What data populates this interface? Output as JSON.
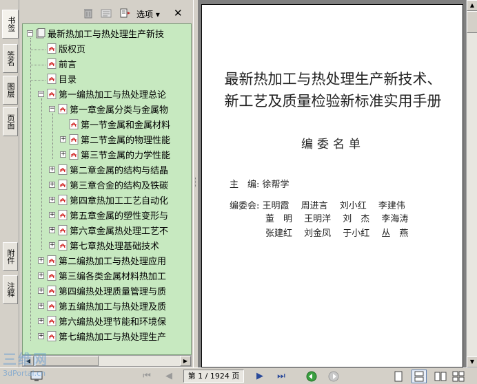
{
  "left_tabs": [
    "书签",
    "签名",
    "图层",
    "页面",
    "附件",
    "注释"
  ],
  "bookmarks_toolbar": {
    "options_label": "选项 ▾",
    "close_glyph": "✕"
  },
  "bookmarks": [
    {
      "label": "最新热加工与热处理生产新技",
      "level": 0,
      "expander": "minus",
      "root": true
    },
    {
      "label": "版权页",
      "level": 1,
      "expander": "none"
    },
    {
      "label": "前言",
      "level": 1,
      "expander": "none"
    },
    {
      "label": "目录",
      "level": 1,
      "expander": "none"
    },
    {
      "label": "第一编热加工与热处理总论",
      "level": 1,
      "expander": "minus"
    },
    {
      "label": "第一章金属分类与金属物",
      "level": 2,
      "expander": "minus"
    },
    {
      "label": "第一节金属和金属材料",
      "level": 3,
      "expander": "none"
    },
    {
      "label": "第二节金属的物理性能",
      "level": 3,
      "expander": "plus"
    },
    {
      "label": "第三节金属的力学性能",
      "level": 3,
      "expander": "plus"
    },
    {
      "label": "第二章金属的结构与结晶",
      "level": 2,
      "expander": "plus"
    },
    {
      "label": "第三章合金的结构及铁碳",
      "level": 2,
      "expander": "plus"
    },
    {
      "label": "第四章热加工工艺自动化",
      "level": 2,
      "expander": "plus"
    },
    {
      "label": "第五章金属的塑性变形与",
      "level": 2,
      "expander": "plus"
    },
    {
      "label": "第六章金属热处理工艺不",
      "level": 2,
      "expander": "plus"
    },
    {
      "label": "第七章热处理基础技术",
      "level": 2,
      "expander": "plus"
    },
    {
      "label": "第二编热加工与热处理应用",
      "level": 1,
      "expander": "plus"
    },
    {
      "label": "第三编各类金属材料热加工",
      "level": 1,
      "expander": "plus"
    },
    {
      "label": "第四编热处理质量管理与质",
      "level": 1,
      "expander": "plus"
    },
    {
      "label": "第五编热加工与热处理及质",
      "level": 1,
      "expander": "plus"
    },
    {
      "label": "第六编热处理节能和环境保",
      "level": 1,
      "expander": "plus"
    },
    {
      "label": "第七编热加工与热处理生产",
      "level": 1,
      "expander": "plus"
    }
  ],
  "document": {
    "title_line1": "最新热加工与热处理生产新技术、",
    "title_line2": "新工艺及质量检验新标准实用手册",
    "subtitle": "编委名单",
    "chief_editor_line": "主　编: 徐帮学",
    "committee_line1": "编委会: 王明霞　 周进言　 刘小红　 李建伟",
    "committee_line2": "　　　　董　明　 王明洋　 刘　杰　 李海涛",
    "committee_line3": "　　　　张建红　 刘金凤　 于小红　 丛　燕"
  },
  "navigation": {
    "page_counter": "第 1 / 1924 页"
  },
  "watermark": {
    "logo_text": "三维网",
    "site_text": "3dPortal.cn"
  },
  "colors": {
    "tree_bg": "#c7e9c0",
    "pdf_red": "#d02020",
    "nav_green": "#3aa040"
  }
}
